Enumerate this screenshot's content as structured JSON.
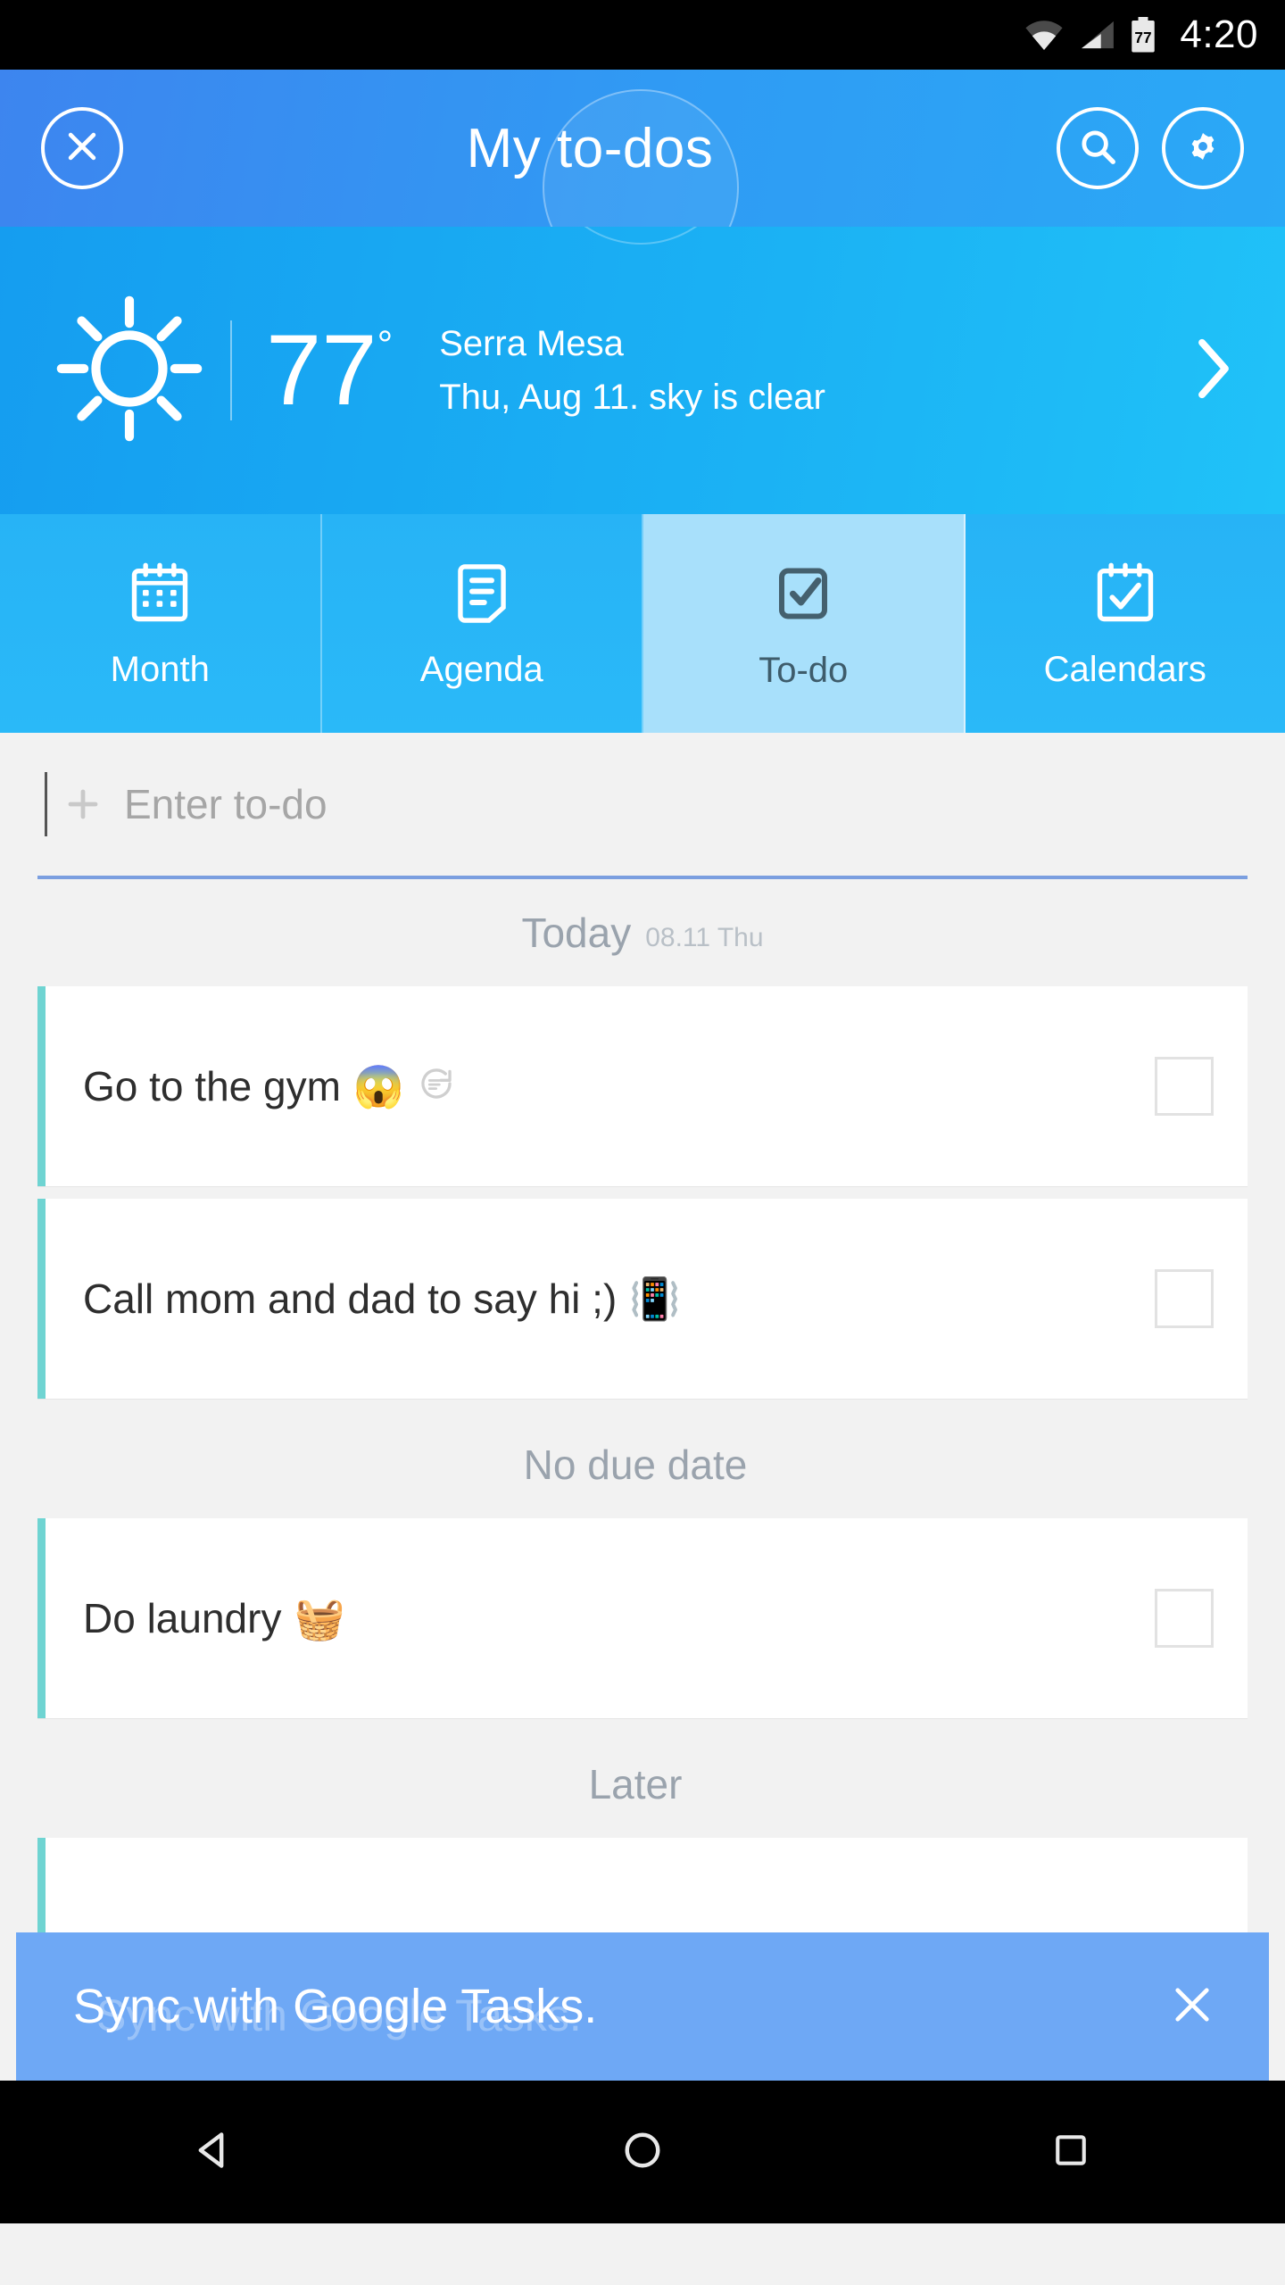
{
  "statusbar": {
    "time": "4:20",
    "battery_level": "77",
    "icons": [
      "wifi-icon",
      "cellular-signal-icon",
      "battery-icon"
    ]
  },
  "appbar": {
    "title": "My to-dos",
    "close_icon": "close-icon",
    "search_icon": "search-icon",
    "settings_icon": "gear-icon"
  },
  "weather": {
    "icon": "sun-icon",
    "temperature": "77",
    "degree_symbol": "°",
    "location": "Serra Mesa",
    "description": "Thu, Aug 11. sky is clear",
    "chevron_icon": "chevron-right-icon"
  },
  "tabs": [
    {
      "label": "Month",
      "icon": "calendar-month-icon",
      "active": false
    },
    {
      "label": "Agenda",
      "icon": "agenda-list-icon",
      "active": false
    },
    {
      "label": "To-do",
      "icon": "checkbox-checked-icon",
      "active": true
    },
    {
      "label": "Calendars",
      "icon": "calendar-check-icon",
      "active": false
    }
  ],
  "entry": {
    "placeholder": "Enter to-do",
    "plus_icon": "plus-icon"
  },
  "sections": [
    {
      "title": "Today",
      "subtitle": "08.11 Thu",
      "tasks": [
        {
          "text": "Go to the gym",
          "emoji": "😱",
          "recurring": true,
          "checked": false
        },
        {
          "text": "Call mom and dad to say hi ;)",
          "emoji": "📳",
          "recurring": false,
          "checked": false
        }
      ]
    },
    {
      "title": "No due date",
      "subtitle": "",
      "tasks": [
        {
          "text": "Do laundry",
          "emoji": "🧺",
          "recurring": false,
          "checked": false
        }
      ]
    },
    {
      "title": "Later",
      "subtitle": "",
      "tasks": []
    }
  ],
  "snackbar": {
    "message": "Sync with Google Tasks.",
    "ghost_message": "Sync with Google Tasks.",
    "close_icon": "close-icon",
    "background_color": "#6ea8f5"
  },
  "navbar": {
    "back_icon": "back-triangle-icon",
    "home_icon": "home-circle-icon",
    "recents_icon": "recents-square-icon"
  },
  "colors": {
    "header_blue_start": "#3d85ef",
    "header_blue_end": "#2aa9f6",
    "weather_blue_start": "#159df0",
    "weather_blue_end": "#20c2f8",
    "tab_blue": "#27b3f6",
    "tab_active": "#a8e0fb",
    "task_accent": "#6fd4d2",
    "snackbar_blue": "#6ea8f5"
  }
}
